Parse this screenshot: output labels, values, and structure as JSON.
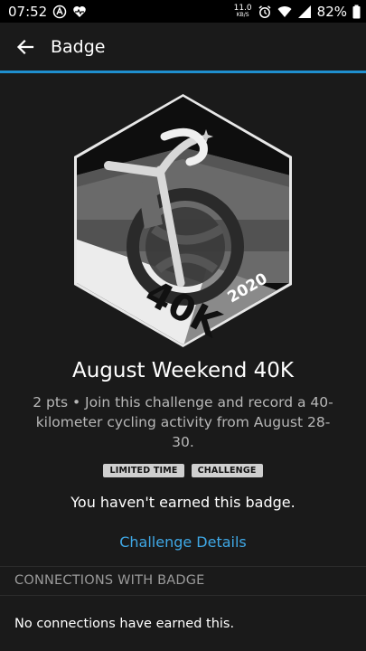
{
  "status_bar": {
    "time": "07:52",
    "net_speed_value": "11.0",
    "net_speed_unit": "KB/S",
    "battery": "82%"
  },
  "app_bar": {
    "title": "Badge"
  },
  "badge": {
    "image_text": "40K",
    "image_year": "2020",
    "title": "August Weekend 40K",
    "description": "2 pts • Join this challenge and record a 40-kilometer cycling activity from August 28-30.",
    "tags": [
      "LIMITED TIME",
      "CHALLENGE"
    ],
    "earned_message": "You haven't earned this badge.",
    "details_link": "Challenge Details"
  },
  "connections": {
    "header": "CONNECTIONS WITH BADGE",
    "empty_message": "No connections have earned this."
  },
  "colors": {
    "accent": "#1f8fcf",
    "link": "#3fa8e6",
    "background": "#1a1a1a"
  }
}
